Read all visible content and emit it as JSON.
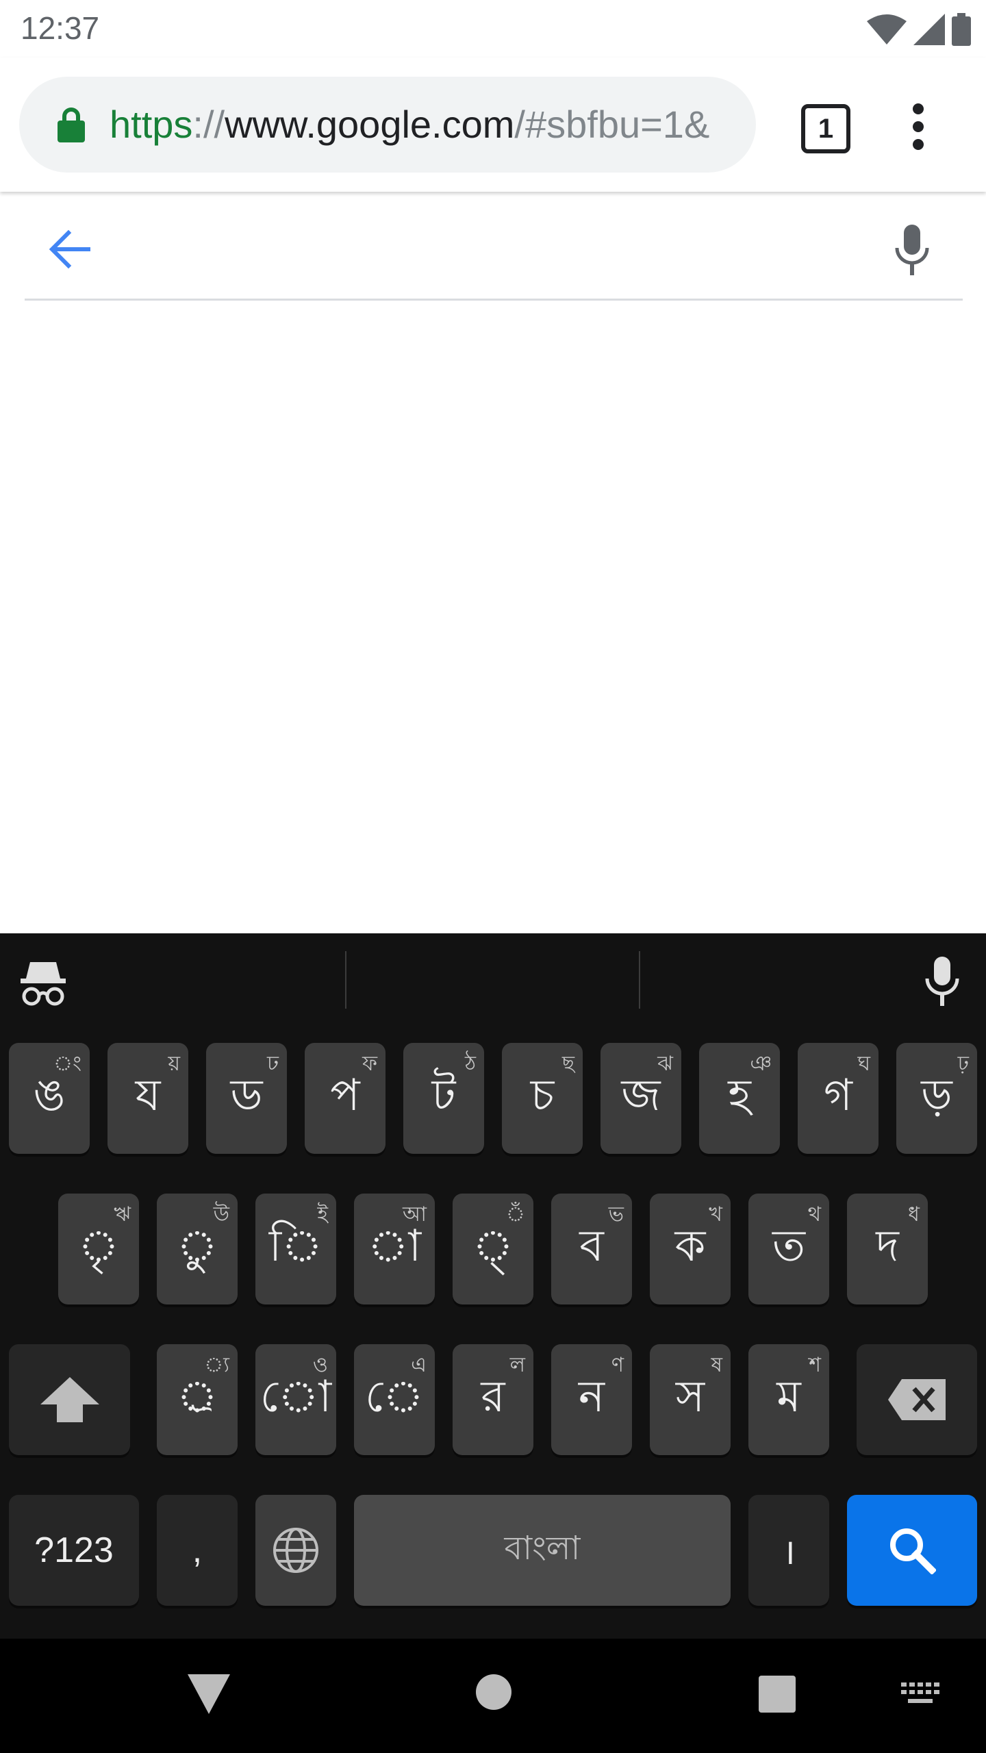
{
  "status_bar": {
    "time": "12:37"
  },
  "omnibox": {
    "url_scheme": "https",
    "url_separator": "://",
    "url_host": "www.google.com",
    "url_path": "/#sbfbu=1&",
    "tab_count": "1"
  },
  "search": {
    "value": "",
    "placeholder": ""
  },
  "keyboard": {
    "row1": [
      {
        "main": "ঙ",
        "hint": "ং"
      },
      {
        "main": "য",
        "hint": "য়"
      },
      {
        "main": "ড",
        "hint": "ঢ"
      },
      {
        "main": "প",
        "hint": "ফ"
      },
      {
        "main": "ট",
        "hint": "ঠ"
      },
      {
        "main": "চ",
        "hint": "ছ"
      },
      {
        "main": "জ",
        "hint": "ঝ"
      },
      {
        "main": "হ",
        "hint": "ঞ"
      },
      {
        "main": "গ",
        "hint": "ঘ"
      },
      {
        "main": "ড়",
        "hint": "ঢ়"
      }
    ],
    "row2": [
      {
        "main": "ৃ",
        "hint": "ঋ"
      },
      {
        "main": "ু",
        "hint": "উ"
      },
      {
        "main": "ি",
        "hint": "ই"
      },
      {
        "main": "া",
        "hint": "আ"
      },
      {
        "main": "্",
        "hint": "ঁ"
      },
      {
        "main": "ব",
        "hint": "ভ"
      },
      {
        "main": "ক",
        "hint": "খ"
      },
      {
        "main": "ত",
        "hint": "থ"
      },
      {
        "main": "দ",
        "hint": "ধ"
      }
    ],
    "row3": [
      {
        "main": "্র",
        "hint": "্য"
      },
      {
        "main": "ো",
        "hint": "ও"
      },
      {
        "main": "ে",
        "hint": "এ"
      },
      {
        "main": "র",
        "hint": "ল"
      },
      {
        "main": "ন",
        "hint": "ণ"
      },
      {
        "main": "স",
        "hint": "ষ"
      },
      {
        "main": "ম",
        "hint": "শ"
      }
    ],
    "symbols_label": "?123",
    "comma_label": ",",
    "space_label": "বাংলা",
    "danda_label": "।"
  },
  "colors": {
    "url_green": "#188038",
    "keyboard_bg": "#121212",
    "key_bg": "#3c3c3c",
    "search_key": "#0a74e9",
    "back_arrow": "#4285f4"
  }
}
